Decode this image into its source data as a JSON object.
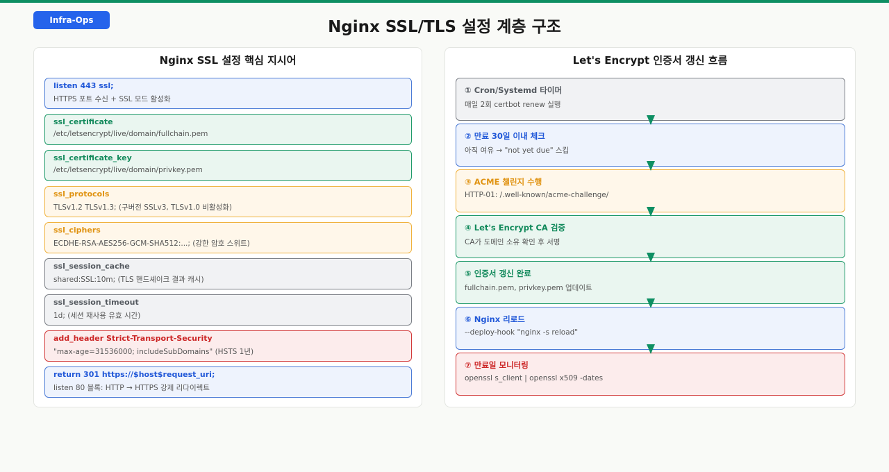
{
  "badge": "Infra-Ops",
  "title": "Nginx SSL/TLS 설정 계층 구조",
  "left_panel": {
    "title": "Nginx SSL 설정 핵심 지시어",
    "items": [
      {
        "key": "listen 443 ssl;",
        "desc": "HTTPS 포트 수신 + SSL 모드 활성화",
        "color": "blue"
      },
      {
        "key": "ssl_certificate",
        "desc": "/etc/letsencrypt/live/domain/fullchain.pem",
        "color": "green"
      },
      {
        "key": "ssl_certificate_key",
        "desc": "/etc/letsencrypt/live/domain/privkey.pem",
        "color": "green"
      },
      {
        "key": "ssl_protocols",
        "desc": "TLSv1.2 TLSv1.3; (구버전 SSLv3, TLSv1.0 비활성화)",
        "color": "orange"
      },
      {
        "key": "ssl_ciphers",
        "desc": "ECDHE-RSA-AES256-GCM-SHA512:...; (강한 암호 스위트)",
        "color": "orange"
      },
      {
        "key": "ssl_session_cache",
        "desc": "shared:SSL:10m; (TLS 핸드셰이크 결과 캐시)",
        "color": "gray"
      },
      {
        "key": "ssl_session_timeout",
        "desc": "1d; (세션 재사용 유효 시간)",
        "color": "gray"
      },
      {
        "key": "add_header Strict-Transport-Security",
        "desc": "\"max-age=31536000; includeSubDomains\" (HSTS 1년)",
        "color": "red"
      },
      {
        "key": "return 301 https://$host$request_uri;",
        "desc": "listen 80 블록: HTTP → HTTPS 강제 리다이렉트",
        "color": "blue"
      }
    ]
  },
  "right_panel": {
    "title": "Let's Encrypt 인증서 갱신 흐름",
    "steps": [
      {
        "key": "① Cron/Systemd 타이머",
        "desc": "매일 2회 certbot renew 실행",
        "color": "gray"
      },
      {
        "key": "② 만료 30일 이내 체크",
        "desc": "아직 여유 → \"not yet due\" 스킵",
        "color": "blue"
      },
      {
        "key": "③ ACME 챌린지 수행",
        "desc": "HTTP-01: /.well-known/acme-challenge/",
        "color": "orange"
      },
      {
        "key": "④ Let's Encrypt CA 검증",
        "desc": "CA가 도메인 소유 확인 후 서명",
        "color": "green"
      },
      {
        "key": "⑤ 인증서 갱신 완료",
        "desc": "fullchain.pem, privkey.pem 업데이트",
        "color": "green"
      },
      {
        "key": "⑥ Nginx 리로드",
        "desc": "--deploy-hook \"nginx -s reload\"",
        "color": "blue"
      },
      {
        "key": "⑦ 만료일 모니터링",
        "desc": "openssl s_client | openssl x509 -dates",
        "color": "red"
      }
    ]
  },
  "colors": {
    "accent": "#0e8f63",
    "badge": "#2563eb",
    "blue": "#4b7bd6",
    "green": "#1f9a6a",
    "orange": "#f0b23d",
    "gray": "#7b7f86",
    "red": "#d23a3a"
  }
}
